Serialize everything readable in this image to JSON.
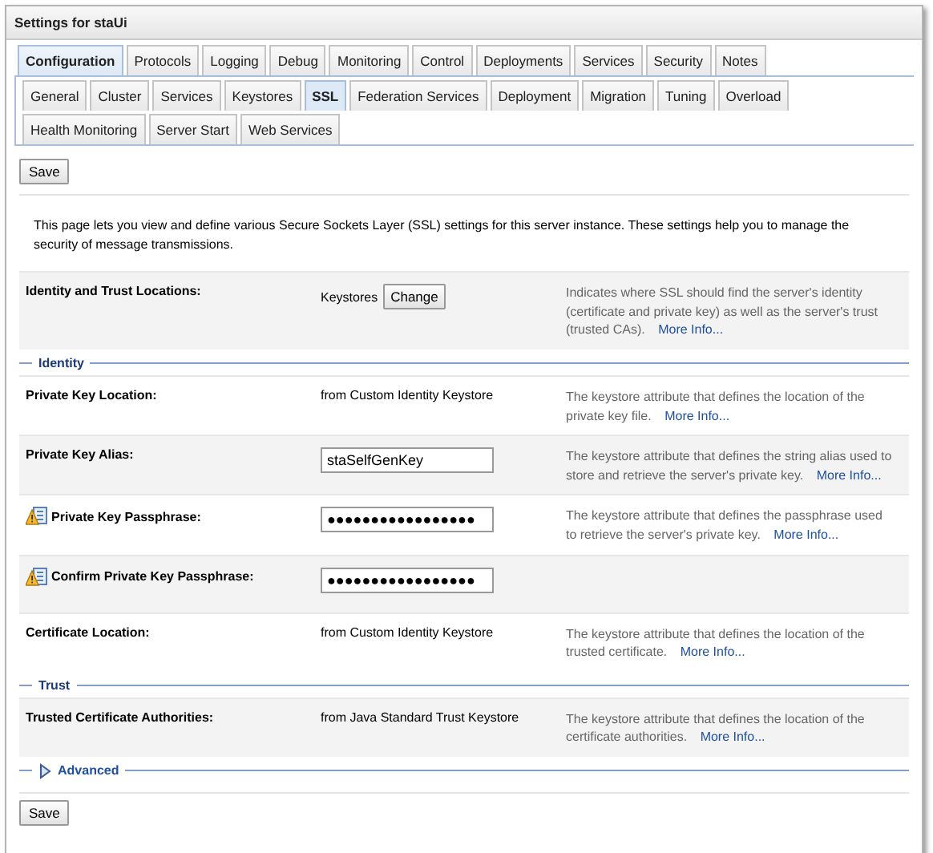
{
  "panel": {
    "title": "Settings for staUi"
  },
  "tabs": [
    {
      "label": "Configuration",
      "selected": true
    },
    {
      "label": "Protocols",
      "selected": false
    },
    {
      "label": "Logging",
      "selected": false
    },
    {
      "label": "Debug",
      "selected": false
    },
    {
      "label": "Monitoring",
      "selected": false
    },
    {
      "label": "Control",
      "selected": false
    },
    {
      "label": "Deployments",
      "selected": false
    },
    {
      "label": "Services",
      "selected": false
    },
    {
      "label": "Security",
      "selected": false
    },
    {
      "label": "Notes",
      "selected": false
    }
  ],
  "subtabs": [
    {
      "label": "General",
      "selected": false
    },
    {
      "label": "Cluster",
      "selected": false
    },
    {
      "label": "Services",
      "selected": false
    },
    {
      "label": "Keystores",
      "selected": false
    },
    {
      "label": "SSL",
      "selected": true
    },
    {
      "label": "Federation Services",
      "selected": false
    },
    {
      "label": "Deployment",
      "selected": false
    },
    {
      "label": "Migration",
      "selected": false
    },
    {
      "label": "Tuning",
      "selected": false
    },
    {
      "label": "Overload",
      "selected": false
    },
    {
      "label": "Health Monitoring",
      "selected": false
    },
    {
      "label": "Server Start",
      "selected": false
    },
    {
      "label": "Web Services",
      "selected": false
    }
  ],
  "save_top": "Save",
  "intro": "This page lets you view and define various Secure Sockets Layer (SSL) settings for this server instance. These settings help you to manage the security of message transmissions.",
  "items": [
    {
      "kind": "button_row",
      "label": "Identity and Trust Locations:",
      "warning": false,
      "value": "Keystores",
      "button": "Change",
      "description": "Indicates where SSL should find the server's identity (certificate and private key) as well as the server's trust (trusted CAs).",
      "link": "More Info..."
    },
    {
      "kind": "section",
      "label": "Identity"
    },
    {
      "kind": "text_row",
      "label": "Private Key Location:",
      "warning": false,
      "value": "from Custom Identity Keystore",
      "description": "The keystore attribute that defines the location of the private key file.",
      "link": "More Info..."
    },
    {
      "kind": "input_row",
      "label": "Private Key Alias:",
      "warning": false,
      "value": "staSelfGenKey",
      "description": "The keystore attribute that defines the string alias used to store and retrieve the server's private key.",
      "link": "More Info..."
    },
    {
      "kind": "input_row",
      "label": "Private Key Passphrase:",
      "warning": true,
      "value": "●●●●●●●●●●●●●●●●●",
      "description": "The keystore attribute that defines the passphrase used to retrieve the server's private key.",
      "link": "More Info..."
    },
    {
      "kind": "input_row",
      "label": "Confirm Private Key Passphrase:",
      "warning": true,
      "value": "●●●●●●●●●●●●●●●●●"
    },
    {
      "kind": "text_row",
      "label": "Certificate Location:",
      "warning": false,
      "value": "from Custom Identity Keystore",
      "description": "The keystore attribute that defines the location of the trusted certificate.",
      "link": "More Info..."
    },
    {
      "kind": "section",
      "label": "Trust"
    },
    {
      "kind": "text_row",
      "label": "Trusted Certificate Authorities:",
      "warning": false,
      "value": "from Java Standard Trust Keystore",
      "description": "The keystore attribute that defines the location of the certificate authorities.",
      "link": "More Info..."
    }
  ],
  "advanced": {
    "label": "Advanced",
    "expanded": false
  },
  "save_bottom": "Save"
}
